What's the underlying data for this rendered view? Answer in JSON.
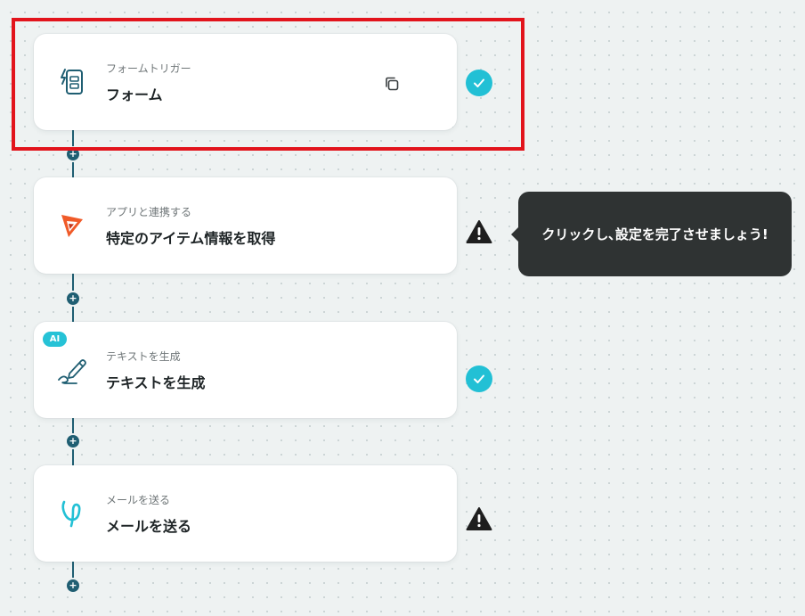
{
  "flow": {
    "add_step_label": "+",
    "steps": [
      {
        "subtitle": "フォームトリガー",
        "title": "フォーム",
        "icon": "form-icon",
        "status": "complete",
        "has_copy_button": true
      },
      {
        "subtitle": "アプリと連携する",
        "title": "特定のアイテム情報を取得",
        "icon": "app-logo-icon",
        "status": "warning"
      },
      {
        "badge": "AI",
        "subtitle": "テキストを生成",
        "title": "テキストを生成",
        "icon": "pen-icon",
        "status": "complete"
      },
      {
        "subtitle": "メールを送る",
        "title": "メールを送る",
        "icon": "mail-app-icon",
        "status": "warning"
      }
    ]
  },
  "tooltip": {
    "text": "クリックし､設定を完了させましょう!"
  },
  "colors": {
    "accent": "#22c0d5",
    "connector": "#1f5e72",
    "warning": "#1e1e1e",
    "highlight": "#e2141c",
    "logo_orange": "#f05a28"
  }
}
